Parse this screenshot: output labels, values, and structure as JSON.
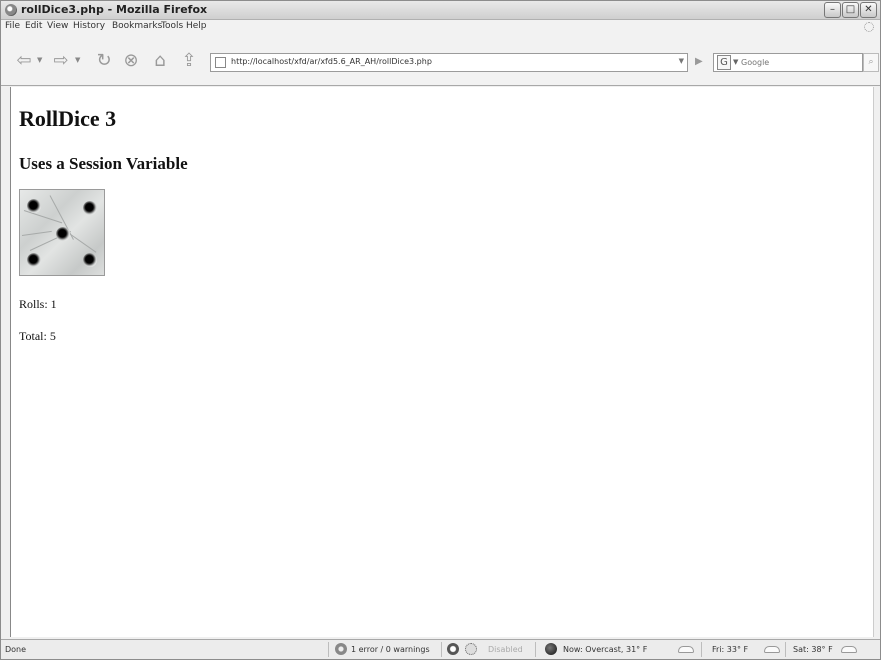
{
  "window": {
    "title": "rollDice3.php - Mozilla Firefox",
    "buttons": {
      "minimize": "–",
      "maximize": "□",
      "close": "✕"
    }
  },
  "menu": {
    "items": [
      "File",
      "Edit",
      "View",
      "History",
      "Bookmarks",
      "Tools",
      "Help"
    ]
  },
  "toolbar": {
    "back": "⇦",
    "forward": "⇨",
    "reload": "↻",
    "stop": "⊗",
    "home": "⌂",
    "bookmark": "⇪",
    "url": "http://localhost/xfd/ar/xfd5.6_AR_AH/rollDice3.php",
    "go": "▶",
    "search_engine": "G",
    "search_placeholder": "Google",
    "search_button": "🔍"
  },
  "page": {
    "heading": "RollDice 3",
    "subheading": "Uses a Session Variable",
    "die_value": 5,
    "rolls_text": "Rolls: 1",
    "total_text": "Total: 5"
  },
  "status": {
    "left": "Done",
    "errors": "1 error / 0 warnings",
    "disabled": "Disabled",
    "weather_now": "Now: Overcast, 31° F",
    "weather_fri": "Fri: 33° F",
    "weather_sat": "Sat: 38° F"
  }
}
